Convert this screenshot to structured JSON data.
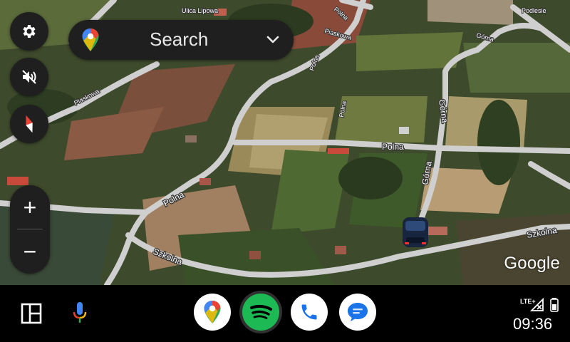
{
  "map": {
    "roads": {
      "polna_1": "Polna",
      "polna_2": "Polna",
      "polna_3": "Polna",
      "polna_4": "Polna",
      "szkolna_1": "Szkolna",
      "szkolna_2": "Szkolna",
      "gorna_1": "Górna",
      "gorna_2": "Górna",
      "gorna_3": "Górna",
      "piaskowa_1": "Piaskowa",
      "piaskowa_2": "Piaskowa",
      "lipowa": "Ulica Lipowa",
      "polna_top": "Polna",
      "podlesie": "Podlesie"
    },
    "attribution": "Google"
  },
  "search": {
    "label": "Search",
    "icon": "google-maps-pin-icon"
  },
  "controls": {
    "settings_icon": "gear-icon",
    "mute_icon": "volume-off-icon",
    "compass_icon": "compass-icon",
    "zoom_in": "+",
    "zoom_out": "−"
  },
  "taskbar": {
    "apps": [
      "Google Maps",
      "Spotify",
      "Phone",
      "Messages"
    ],
    "status": {
      "network": "LTE+",
      "time": "09:36"
    }
  },
  "colors": {
    "road": "#cfcfcf",
    "panel": "#1f1f1f",
    "spotify_green": "#1db954",
    "phone_blue": "#1a73e8"
  }
}
